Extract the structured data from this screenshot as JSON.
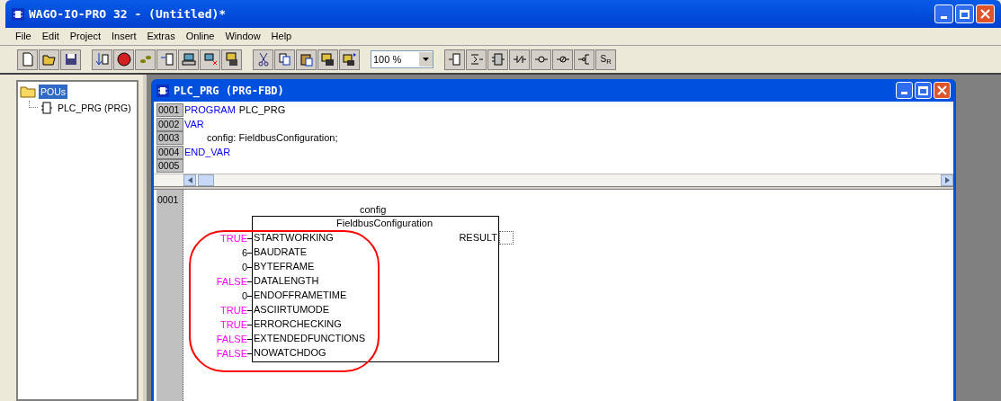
{
  "window": {
    "title": "WAGO-IO-PRO 32 - (Untitled)*"
  },
  "menu": [
    {
      "label": "File"
    },
    {
      "label": "Edit"
    },
    {
      "label": "Project"
    },
    {
      "label": "Insert"
    },
    {
      "label": "Extras"
    },
    {
      "label": "Online"
    },
    {
      "label": "Window"
    },
    {
      "label": "Help"
    }
  ],
  "toolbar": {
    "zoom": "100 %",
    "set_reset": "S$_{R}$"
  },
  "tree": [
    {
      "label": "POUs",
      "selected": true,
      "children": [
        {
          "label": "PLC_PRG (PRG)",
          "selected": false
        }
      ]
    }
  ],
  "editor": {
    "title": "PLC_PRG (PRG-FBD)",
    "declaration": [
      {
        "number": "0001",
        "tokens": [
          {
            "text": "PROGRAM",
            "kind": "keyword"
          },
          {
            "text": "PLC_PRG",
            "kind": "plain"
          }
        ]
      },
      {
        "number": "0002",
        "tokens": [
          {
            "text": "VAR",
            "kind": "keyword"
          }
        ]
      },
      {
        "number": "0003",
        "tokens": [
          {
            "text": "config: FieldbusConfiguration;",
            "kind": "indent"
          }
        ]
      },
      {
        "number": "0004",
        "tokens": [
          {
            "text": "END_VAR",
            "kind": "keyword"
          }
        ]
      },
      {
        "number": "0005"
      }
    ],
    "network": {
      "number": "0001",
      "instance": "config",
      "type": "FieldbusConfiguration",
      "inputs": [
        {
          "value": "TRUE",
          "kind": "bool",
          "name": "STARTWORKING"
        },
        {
          "value": "6",
          "kind": "number",
          "name": "BAUDRATE"
        },
        {
          "value": "0",
          "kind": "number",
          "name": "BYTEFRAME"
        },
        {
          "value": "FALSE",
          "kind": "bool",
          "name": "DATALENGTH"
        },
        {
          "value": "0",
          "kind": "number",
          "name": "ENDOFFRAMETIME"
        },
        {
          "value": "TRUE",
          "kind": "bool",
          "name": "ASCIIRTUMODE"
        },
        {
          "value": "TRUE",
          "kind": "bool",
          "name": "ERRORCHECKING"
        },
        {
          "value": "FALSE",
          "kind": "bool",
          "name": "EXTENDEDFUNCTIONS"
        },
        {
          "value": "FALSE",
          "kind": "bool",
          "name": "NOWATCHDOG"
        }
      ],
      "outputs": [
        {
          "name": "RESULT"
        }
      ]
    }
  }
}
